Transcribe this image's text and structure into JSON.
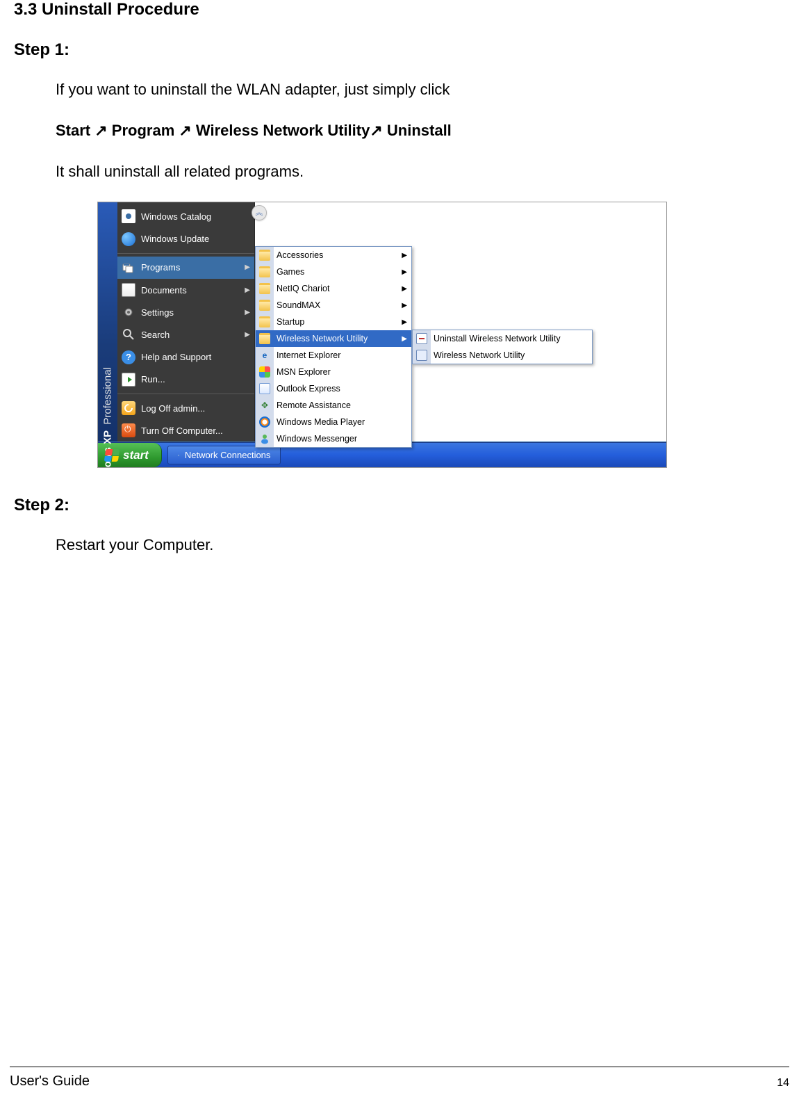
{
  "section_title": "3.3 Uninstall Procedure",
  "step1": "Step 1:",
  "body1": "If you want to uninstall the WLAN adapter, just simply click",
  "path_line": "Start ↗ Program   ↗   Wireless Network Utility↗ Uninstall",
  "body2": "It shall uninstall all related programs.",
  "xp_brand_pro": "Professional",
  "xp_brand_xp": "Windows XP",
  "collapse_glyph": "︽",
  "start_items": {
    "catalog": "Windows Catalog",
    "update": "Windows Update",
    "programs": "Programs",
    "documents": "Documents",
    "settings": "Settings",
    "search": "Search",
    "help": "Help and Support",
    "run": "Run...",
    "logoff": "Log Off admin...",
    "turnoff": "Turn Off Computer..."
  },
  "programs_menu": {
    "accessories": "Accessories",
    "games": "Games",
    "netiq": "NetIQ Chariot",
    "soundmax": "SoundMAX",
    "startup": "Startup",
    "wnu": "Wireless Network Utility",
    "ie": "Internet Explorer",
    "msn": "MSN Explorer",
    "outlook": "Outlook Express",
    "remote": "Remote Assistance",
    "wmp": "Windows Media Player",
    "wm": "Windows Messenger"
  },
  "wnu_menu": {
    "uninstall": "Uninstall Wireless Network Utility",
    "utility": "Wireless Network Utility"
  },
  "taskbar": {
    "start": "start",
    "netconn": "Network Connections"
  },
  "step2": "Step 2:",
  "body3": "Restart your Computer.",
  "footer": {
    "left": "User's Guide",
    "page": "14"
  }
}
